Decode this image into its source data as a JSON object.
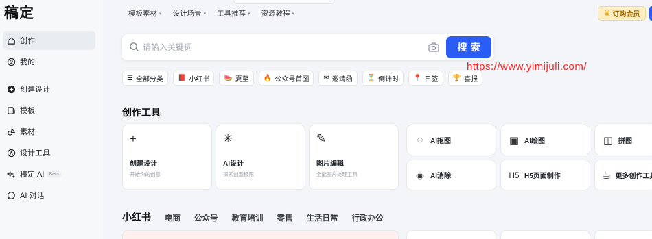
{
  "app": {
    "logo": "稿定"
  },
  "sidebar": {
    "items": [
      {
        "label": "创作",
        "icon": "home-icon"
      },
      {
        "label": "我的",
        "icon": "user-icon"
      },
      {
        "label": "创建设计",
        "icon": "plus-circle-icon"
      },
      {
        "label": "模板",
        "icon": "template-icon"
      },
      {
        "label": "素材",
        "icon": "shapes-icon"
      },
      {
        "label": "设计工具",
        "icon": "tool-icon"
      },
      {
        "label": "稿定 AI",
        "badge": "Beta",
        "icon": "ai-spark-icon"
      },
      {
        "label": "AI 对话",
        "icon": "chat-icon"
      }
    ]
  },
  "topnav": {
    "items": [
      {
        "label": "模板素材"
      },
      {
        "label": "设计场景"
      },
      {
        "label": "工具推荐"
      },
      {
        "label": "资源教程"
      }
    ],
    "vip_label": "订购会员"
  },
  "search": {
    "placeholder": "请输入关键词",
    "button": "搜索"
  },
  "watermark": "https://www.yimijuli.com/",
  "chips": [
    {
      "label": "全部分类",
      "icon": "☰"
    },
    {
      "label": "小红书",
      "icon": "📕"
    },
    {
      "label": "夏至",
      "icon": "🍉"
    },
    {
      "label": "公众号首图",
      "icon": "🔥"
    },
    {
      "label": "邀请函",
      "icon": "✉"
    },
    {
      "label": "倒计时",
      "icon": "⏳"
    },
    {
      "label": "日签",
      "icon": "📍"
    },
    {
      "label": "喜报",
      "icon": "🏆"
    }
  ],
  "creation_tools": {
    "title": "创作工具",
    "large": [
      {
        "title": "创建设计",
        "desc": "开始你的创意",
        "icon": "+"
      },
      {
        "title": "AI设计",
        "desc": "探索创造极限",
        "icon": "✳"
      },
      {
        "title": "图片编辑",
        "desc": "全能图片处理工具",
        "icon": "✎"
      }
    ],
    "small": [
      {
        "title": "AI抠图",
        "icon": "◌"
      },
      {
        "title": "AI绘图",
        "icon": "▣"
      },
      {
        "title": "拼图",
        "icon": "◫"
      },
      {
        "title": "AI消除",
        "icon": "◈"
      },
      {
        "title": "H5页面制作",
        "icon": "H5"
      },
      {
        "title": "更多创作工具",
        "icon": "☕"
      }
    ]
  },
  "bottom_tabs": {
    "main": "小红书",
    "items": [
      "电商",
      "公众号",
      "教育培训",
      "零售",
      "生活日常",
      "行政办公"
    ]
  }
}
